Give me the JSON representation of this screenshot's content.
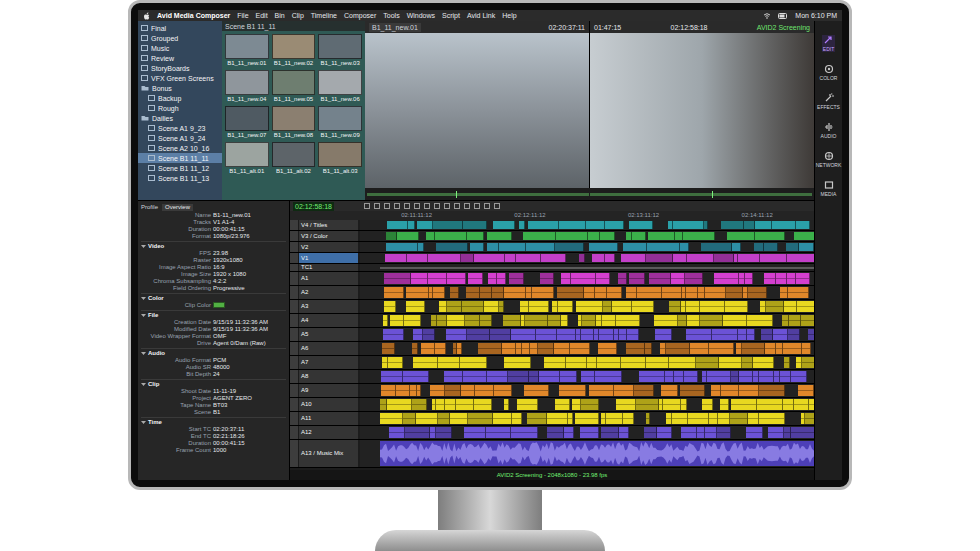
{
  "menubar": {
    "app": "Avid Media Composer",
    "items": [
      "File",
      "Edit",
      "Bin",
      "Clip",
      "Timeline",
      "Composer",
      "Tools",
      "Windows",
      "Script",
      "Avid Link",
      "Help"
    ],
    "clock": "Mon 6:10 PM"
  },
  "bins": {
    "title": "Scene B1 11_11",
    "items": [
      {
        "label": "Final",
        "kind": "bin",
        "selected": false,
        "children": []
      },
      {
        "label": "Grouped",
        "kind": "bin",
        "selected": false,
        "children": []
      },
      {
        "label": "Music",
        "kind": "bin",
        "selected": false,
        "children": []
      },
      {
        "label": "Review",
        "kind": "bin",
        "selected": false,
        "children": []
      },
      {
        "label": "StoryBoards",
        "kind": "bin",
        "selected": false,
        "children": []
      },
      {
        "label": "VFX Green Screens",
        "kind": "bin",
        "selected": false,
        "children": []
      },
      {
        "label": "Bonus",
        "kind": "folder",
        "selected": false,
        "children": [
          {
            "label": "Backup",
            "kind": "bin",
            "selected": false
          },
          {
            "label": "Rough",
            "kind": "bin",
            "selected": false
          }
        ]
      },
      {
        "label": "Dailies",
        "kind": "folder",
        "selected": false,
        "children": [
          {
            "label": "Scene A1 9_23",
            "kind": "bin",
            "selected": false
          },
          {
            "label": "Scene A1 9_24",
            "kind": "bin",
            "selected": false
          },
          {
            "label": "Scene A2 10_16",
            "kind": "bin",
            "selected": false
          },
          {
            "label": "Scene B1 11_11",
            "kind": "bin",
            "selected": true
          },
          {
            "label": "Scene B1 11_12",
            "kind": "bin",
            "selected": false
          },
          {
            "label": "Scene B1 11_13",
            "kind": "bin",
            "selected": false
          }
        ]
      }
    ]
  },
  "thumbnails": [
    {
      "label": "B1_11_new.01"
    },
    {
      "label": "B1_11_new.02"
    },
    {
      "label": "B1_11_new.03"
    },
    {
      "label": "B1_11_new.04"
    },
    {
      "label": "B1_11_new.05"
    },
    {
      "label": "B1_11_new.06"
    },
    {
      "label": "B1_11_new.07"
    },
    {
      "label": "B1_11_new.08"
    },
    {
      "label": "B1_11_new.09"
    },
    {
      "label": "B1_11_alt.01"
    },
    {
      "label": "B1_11_alt.02"
    },
    {
      "label": "B1_11_alt.03"
    }
  ],
  "source": {
    "clip": "B1_11_new.01",
    "tc": "02:20:37:11"
  },
  "record": {
    "duration": "01:47:15",
    "tc": "02:12:58:18",
    "sequence": "AVID2 Screening"
  },
  "toolbar": [
    {
      "label": "EDIT",
      "selected": true
    },
    {
      "label": "COLOR",
      "selected": false
    },
    {
      "label": "EFFECTS",
      "selected": false
    },
    {
      "label": "AUDIO",
      "selected": false
    },
    {
      "label": "NETWORK",
      "selected": false
    },
    {
      "label": "MEDIA",
      "selected": false
    }
  ],
  "inspector": {
    "profile": {
      "label": "Profile",
      "value": "Overview"
    },
    "fields": [
      {
        "label": "Name",
        "value": "B1-11_new.01"
      },
      {
        "label": "Tracks",
        "value": "V1 A1-4"
      },
      {
        "label": "Duration",
        "value": "00:00:41:15"
      },
      {
        "label": "Format",
        "value": "1080p/23.976"
      }
    ],
    "sections": [
      {
        "title": "Video",
        "rows": [
          {
            "kind": "text",
            "label": "FPS",
            "value": "23.98"
          },
          {
            "kind": "text",
            "label": "Raster",
            "value": "1920x1080"
          },
          {
            "kind": "text",
            "label": "Image Aspect Ratio",
            "value": "16:9"
          },
          {
            "kind": "text",
            "label": "Image Size",
            "value": "1920 x 1080"
          },
          {
            "kind": "text",
            "label": "Chroma Subsampling",
            "value": "4:2:2"
          },
          {
            "kind": "text",
            "label": "Field Ordering",
            "value": "Progressive"
          }
        ]
      },
      {
        "title": "Color",
        "rows": [
          {
            "kind": "swatch",
            "label": "Clip Color",
            "color": "#52b043"
          }
        ]
      },
      {
        "title": "File",
        "rows": [
          {
            "kind": "text",
            "label": "Creation Date",
            "value": "9/15/19 11:32:36 AM"
          },
          {
            "kind": "text",
            "label": "Modified Date",
            "value": "9/15/19 11:32:36 AM"
          },
          {
            "kind": "text",
            "label": "Video Wrapper Format",
            "value": "OMF"
          },
          {
            "kind": "text",
            "label": "Drive",
            "value": "Agent 0/Dam (Raw)"
          }
        ]
      },
      {
        "title": "Audio",
        "rows": [
          {
            "kind": "text",
            "label": "Audio Format",
            "value": "PCM"
          },
          {
            "kind": "text",
            "label": "Audio SR",
            "value": "48000"
          },
          {
            "kind": "text",
            "label": "Bit Depth",
            "value": "24"
          }
        ]
      },
      {
        "title": "Clip",
        "rows": [
          {
            "kind": "text",
            "label": "Shoot Date",
            "value": "11-11-19"
          },
          {
            "kind": "text",
            "label": "Project",
            "value": "AGENT ZERO"
          },
          {
            "kind": "text",
            "label": "Tape Name",
            "value": "BT03"
          },
          {
            "kind": "text",
            "label": "Scene",
            "value": "B1"
          }
        ]
      },
      {
        "title": "Time",
        "rows": [
          {
            "kind": "text",
            "label": "Start TC",
            "value": "02:20:37:11"
          },
          {
            "kind": "text",
            "label": "End TC",
            "value": "02:21:18:26"
          },
          {
            "kind": "text",
            "label": "Duration",
            "value": "00:00:41:15"
          },
          {
            "kind": "text",
            "label": "Frame Count",
            "value": "1000"
          }
        ]
      }
    ]
  },
  "timeline": {
    "timecode": "02:12:58:18",
    "ruler": [
      "02:11:11:12",
      "02:12:11:12",
      "02:13:11:12",
      "02:14:11:12"
    ],
    "tracks": [
      {
        "name": "V4 / Titles",
        "kind": "video",
        "color": "#2aa0a8",
        "selected": false
      },
      {
        "name": "V3 / Color",
        "kind": "video",
        "color": "#3bb04a",
        "selected": false
      },
      {
        "name": "V2",
        "kind": "video",
        "color": "#2d8fa6",
        "selected": false
      },
      {
        "name": "V1",
        "kind": "video",
        "color": "#c23fc8",
        "selected": true
      },
      {
        "name": "TC1",
        "kind": "tc",
        "color": "#5a5a5a",
        "selected": false
      },
      {
        "name": "A1",
        "kind": "audio",
        "color": "#d43fd0",
        "selected": false
      },
      {
        "name": "A2",
        "kind": "audio",
        "color": "#e0872a",
        "selected": false
      },
      {
        "name": "A3",
        "kind": "audio",
        "color": "#e8d820",
        "selected": false
      },
      {
        "name": "A4",
        "kind": "audio",
        "color": "#e8d820",
        "selected": false
      },
      {
        "name": "A5",
        "kind": "audio",
        "color": "#6b52d6",
        "selected": false
      },
      {
        "name": "A6",
        "kind": "audio",
        "color": "#e0872a",
        "selected": false
      },
      {
        "name": "A7",
        "kind": "audio",
        "color": "#e8d820",
        "selected": false
      },
      {
        "name": "A8",
        "kind": "audio",
        "color": "#6b52d6",
        "selected": false
      },
      {
        "name": "A9",
        "kind": "audio",
        "color": "#e0872a",
        "selected": false
      },
      {
        "name": "A10",
        "kind": "audio",
        "color": "#e8d820",
        "selected": false
      },
      {
        "name": "A11",
        "kind": "audio",
        "color": "#e8d820",
        "selected": false
      },
      {
        "name": "A12",
        "kind": "audio",
        "color": "#6b52d6",
        "selected": false
      },
      {
        "name": "A13 / Music Mix",
        "kind": "mix",
        "color": "#4d3fb8",
        "selected": false
      }
    ],
    "status": "AVID2 Screening - 2048x1080 - 23.98 fps"
  }
}
